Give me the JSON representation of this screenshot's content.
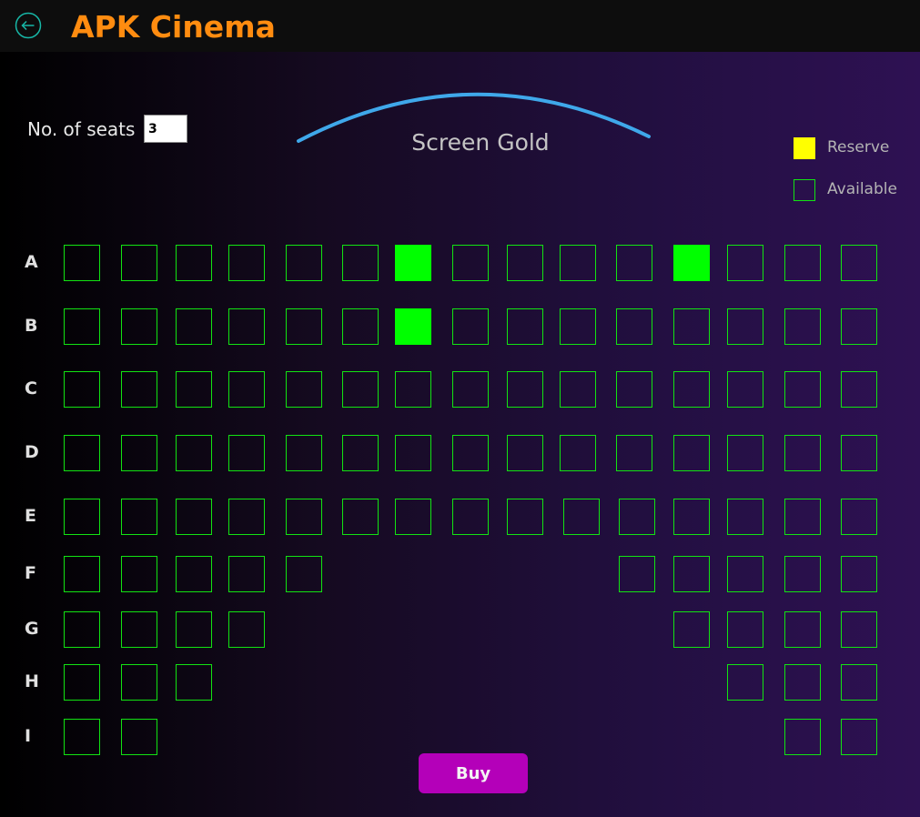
{
  "app": {
    "title": "APK Cinema",
    "back_icon": "back-arrow-circle-icon",
    "title_color": "#ff8c10"
  },
  "booking": {
    "seats_label": "No. of seats",
    "seats_value": "3"
  },
  "screen": {
    "label": "Screen Gold",
    "arc_color": "#3fa8ea"
  },
  "legend": {
    "reserve_label": "Reserve",
    "reserve_color": "#ffff00",
    "available_label": "Available",
    "available_color": "#12e312"
  },
  "seat_map": {
    "rows": [
      "A",
      "B",
      "C",
      "D",
      "E",
      "F",
      "G",
      "H",
      "I"
    ],
    "seats_per_full_row": 15,
    "reserved_color": "#00ff00",
    "seat_indices": {
      "A": [
        0,
        1,
        2,
        3,
        4,
        5,
        6,
        7,
        8,
        9,
        10,
        11,
        12,
        13,
        14
      ],
      "B": [
        0,
        1,
        2,
        3,
        4,
        5,
        6,
        7,
        8,
        9,
        10,
        11,
        12,
        13,
        14
      ],
      "C": [
        0,
        1,
        2,
        3,
        4,
        5,
        6,
        7,
        8,
        9,
        10,
        11,
        12,
        13,
        14
      ],
      "D": [
        0,
        1,
        2,
        3,
        4,
        5,
        6,
        7,
        8,
        9,
        10,
        11,
        12,
        13,
        14
      ],
      "E": [
        0,
        1,
        2,
        3,
        4,
        5,
        6,
        7,
        8,
        9,
        10,
        11,
        12,
        13,
        14
      ],
      "F": [
        0,
        1,
        2,
        3,
        4,
        10,
        11,
        12,
        13,
        14
      ],
      "G": [
        0,
        1,
        2,
        3,
        11,
        12,
        13,
        14
      ],
      "H": [
        0,
        1,
        2,
        12,
        13,
        14
      ],
      "I": [
        0,
        1,
        13,
        14
      ]
    },
    "reserved": {
      "A": [
        6,
        11
      ],
      "B": [
        6
      ]
    }
  },
  "actions": {
    "buy_label": "Buy",
    "buy_color": "#b400b9"
  }
}
